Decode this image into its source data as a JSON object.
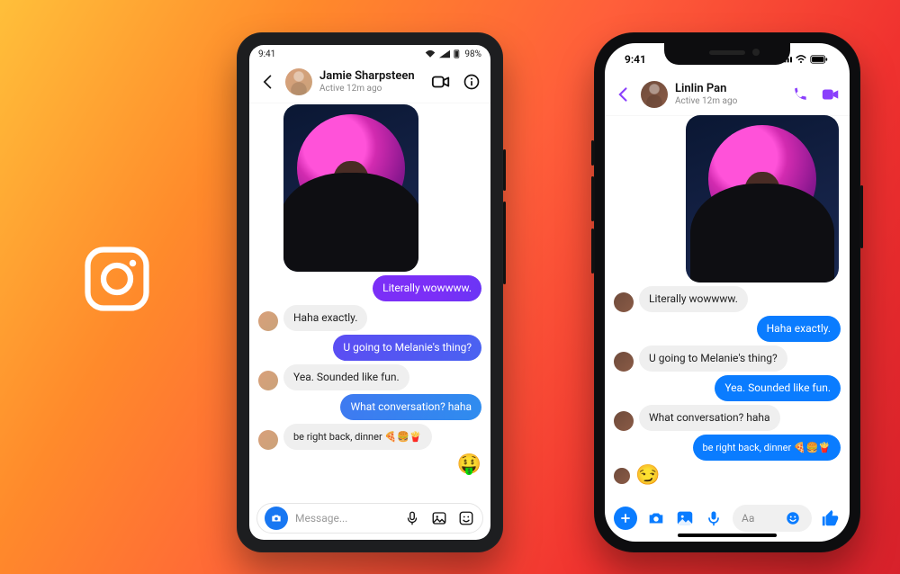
{
  "phones": {
    "android": {
      "status": {
        "time": "9:41",
        "battery": "98%"
      },
      "header": {
        "name": "Jamie Sharpsteen",
        "active": "Active 12m ago"
      },
      "messages": {
        "m1": "Literally wowwww.",
        "m2": "Haha exactly.",
        "m3": "U going to Melanie's thing?",
        "m4": "Yea. Sounded like fun.",
        "m5": "What conversation? haha",
        "m6": "be right back, dinner 🍕🍔🍟",
        "reaction": "🤑"
      },
      "composer": {
        "placeholder": "Message..."
      }
    },
    "iphone": {
      "status": {
        "time": "9:41"
      },
      "header": {
        "name": "Linlin Pan",
        "active": "Active 12m ago"
      },
      "messages": {
        "m1": "Literally wowwww.",
        "m2": "Haha exactly.",
        "m3": "U going to Melanie's thing?",
        "m4": "Yea. Sounded like fun.",
        "m5": "What conversation? haha",
        "m6": "be right back, dinner 🍕🍔🍟",
        "reaction": "😏"
      },
      "composer": {
        "placeholder": "Aa"
      }
    }
  }
}
